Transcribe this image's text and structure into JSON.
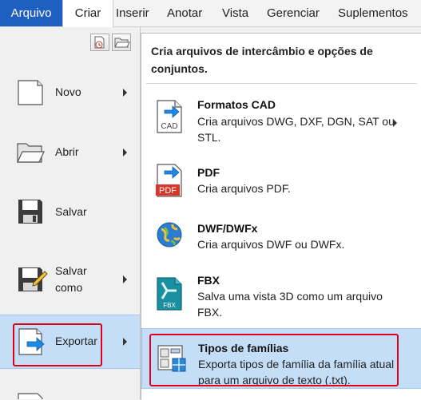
{
  "ribbon": {
    "tabs": [
      "Arquivo",
      "Criar",
      "Inserir",
      "Anotar",
      "Vista",
      "Gerenciar",
      "Suplementos"
    ]
  },
  "app_menu": {
    "items": [
      {
        "label": "Novo",
        "has_submenu": true
      },
      {
        "label": "Abrir",
        "has_submenu": true
      },
      {
        "label": "Salvar",
        "has_submenu": false
      },
      {
        "label": "Salvar\ncomo",
        "has_submenu": true
      },
      {
        "label": "Exportar",
        "has_submenu": true,
        "selected": true
      }
    ]
  },
  "export_menu": {
    "header": "Cria arquivos de intercâmbio e opções de conjuntos.",
    "items": [
      {
        "title": "Formatos CAD",
        "desc": "Cria arquivos DWG, DXF, DGN, SAT ou STL.",
        "icon": "cad-file-icon",
        "icon_text": "CAD",
        "has_submenu": true
      },
      {
        "title": "PDF",
        "desc": "Cria arquivos PDF.",
        "icon": "pdf-file-icon",
        "icon_text": "PDF"
      },
      {
        "title": "DWF/DWFx",
        "desc": "Cria arquivos DWF ou DWFx.",
        "icon": "dwf-globe-icon"
      },
      {
        "title": "FBX",
        "desc": "Salva uma vista 3D como um arquivo FBX.",
        "icon": "fbx-file-icon",
        "icon_text": "FBX"
      },
      {
        "title": "Tipos de famílias",
        "desc": "Exporta tipos de família da família atual para um arquivo de texto (.txt).",
        "icon": "family-types-icon",
        "selected": true
      }
    ]
  },
  "colors": {
    "accent": "#1f5fbf",
    "selection": "#c5def7",
    "highlight": "#e0001a",
    "arrow": "#1e88e5",
    "pdf": "#d9352b",
    "fbx": "#1a8fa0"
  }
}
